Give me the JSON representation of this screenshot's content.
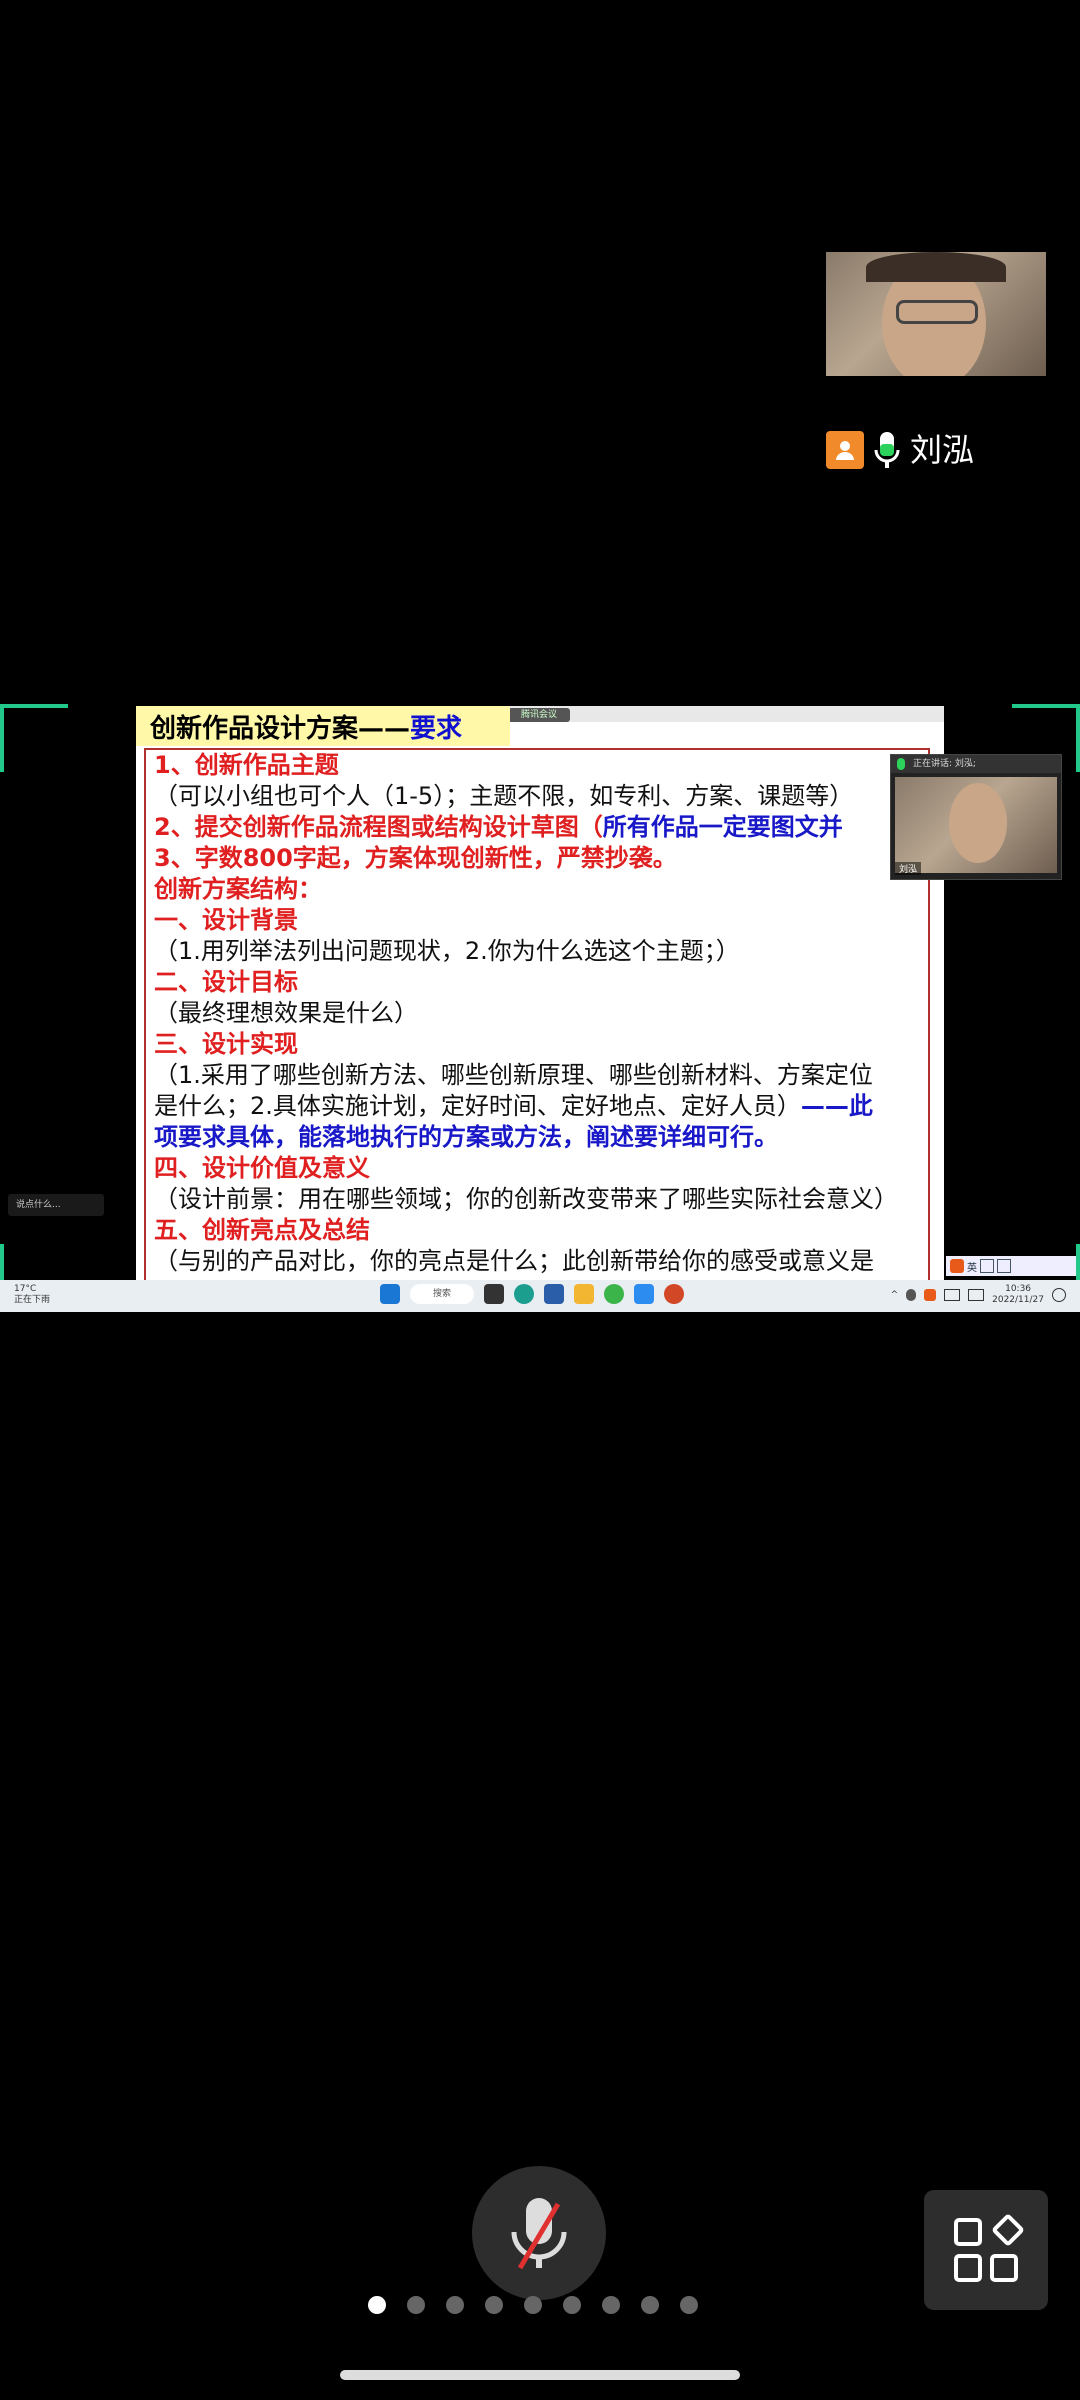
{
  "speaker": {
    "name": "刘泓"
  },
  "slide": {
    "title_black": "创新作品设计方案——",
    "title_blue": "要求",
    "lines": [
      {
        "class": "red",
        "text": "1、创新作品主题"
      },
      {
        "class": "blk",
        "text": "（可以小组也可个人（1-5）；主题不限，如专利、方案、课题等）"
      },
      {
        "class": "red",
        "text": "2、提交创新作品流程图或结构设计草图（",
        "extra": "所有作品一定要图文并"
      },
      {
        "class": "red",
        "text": "3、字数800字起，方案体现创新性，严禁抄袭。"
      },
      {
        "class": "red",
        "text": "创新方案结构："
      },
      {
        "class": "red",
        "text": "一、设计背景"
      },
      {
        "class": "blk",
        "text": "（1.用列举法列出问题现状，2.你为什么选这个主题；）"
      },
      {
        "class": "red",
        "text": "二、设计目标"
      },
      {
        "class": "blk",
        "text": "（最终理想效果是什么）"
      },
      {
        "class": "red",
        "text": "三、设计实现"
      },
      {
        "class": "blk",
        "text": "（1.采用了哪些创新方法、哪些创新原理、哪些创新材料、方案定位"
      },
      {
        "class": "blk",
        "text": "是什么；2.具体实施计划，定好时间、定好地点、定好人员）",
        "extra": "——此"
      },
      {
        "class": "blu",
        "text": "项要求具体，能落地执行的方案或方法，阐述要详细可行。"
      },
      {
        "class": "red",
        "text": "四、设计价值及意义"
      },
      {
        "class": "blk",
        "text": "（设计前景：用在哪些领域；你的创新改变带来了哪些实际社会意义）"
      },
      {
        "class": "red",
        "text": "五、创新亮点及总结"
      },
      {
        "class": "blk",
        "text": "（与别的产品对比，你的亮点是什么；此创新带给你的感受或意义是"
      }
    ],
    "pill_label": "腾讯会议",
    "mini_video_label": "正在讲话: 刘泓;",
    "mini_video_name": "刘泓",
    "side_note": "说点什么...",
    "ime_label": "英"
  },
  "taskbar": {
    "weather_temp": "17°C",
    "weather_desc": "正在下雨",
    "search_label": "搜索",
    "time": "10:36",
    "date": "2022/11/27"
  },
  "pager": {
    "count": 9,
    "active_index": 0
  },
  "colors": {
    "corner_accent": "#22c98a",
    "avatar_orange": "#f08a2b",
    "mic_muted_red": "#e03030"
  }
}
